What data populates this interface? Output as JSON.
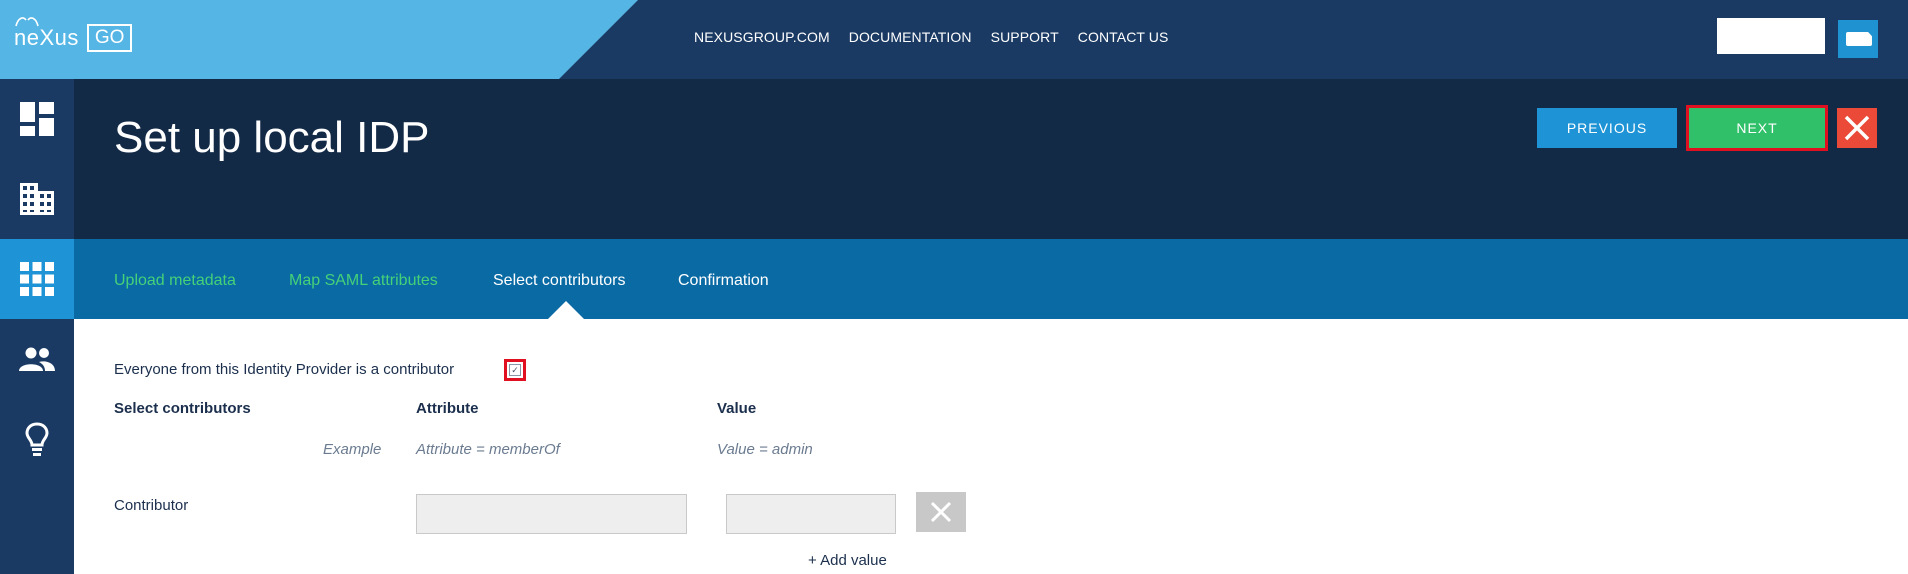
{
  "brand": {
    "logo_text": "neXus",
    "product": "GO"
  },
  "topnav": {
    "links": [
      {
        "label": "NEXUSGROUP.COM"
      },
      {
        "label": "DOCUMENTATION"
      },
      {
        "label": "SUPPORT"
      },
      {
        "label": "CONTACT US"
      }
    ]
  },
  "sidebar": {
    "items": [
      {
        "icon": "dashboard-icon",
        "active": false
      },
      {
        "icon": "building-icon",
        "active": false
      },
      {
        "icon": "apps-grid-icon",
        "active": true
      },
      {
        "icon": "users-icon",
        "active": false
      },
      {
        "icon": "lightbulb-icon",
        "active": false
      }
    ]
  },
  "header": {
    "title": "Set up local IDP",
    "previous_label": "PREVIOUS",
    "next_label": "NEXT",
    "close_icon": "close-icon"
  },
  "tabs": [
    {
      "label": "Upload metadata",
      "state": "done"
    },
    {
      "label": "Map SAML attributes",
      "state": "done"
    },
    {
      "label": "Select contributors",
      "state": "current"
    },
    {
      "label": "Confirmation",
      "state": "pending"
    }
  ],
  "form": {
    "everyone_label": "Everyone from this Identity Provider is a contributor",
    "everyone_checked": true,
    "col_select": "Select contributors",
    "col_attribute": "Attribute",
    "col_value": "Value",
    "example_label": "Example",
    "example_attribute": "Attribute = memberOf",
    "example_value": "Value = admin",
    "contributor_label": "Contributor",
    "attribute_value": "",
    "value_value": "",
    "add_value_label": "+ Add value"
  },
  "colors": {
    "topbar": "#1a3a63",
    "brand_bg": "#55b6e6",
    "header": "#132a47",
    "tabbar": "#0a6aa4",
    "accent_blue": "#1e93d5",
    "next_green": "#31c06a",
    "close_red": "#ea4a37",
    "done_green": "#45d178",
    "highlight_red": "#e01020"
  }
}
